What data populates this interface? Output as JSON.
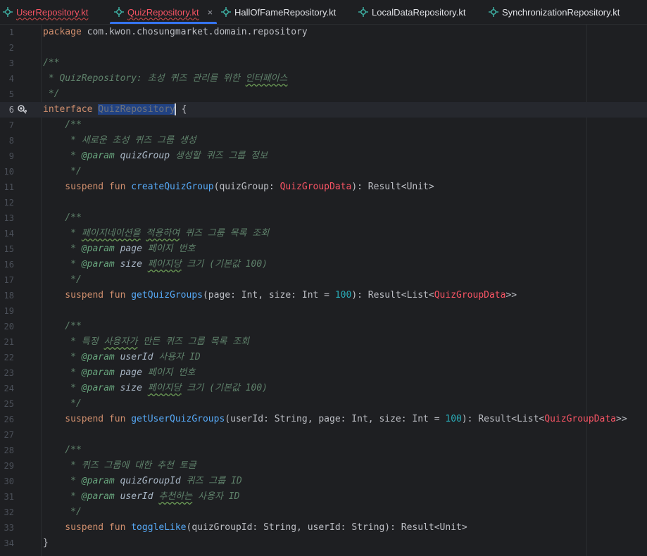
{
  "tabs": [
    {
      "label": "UserRepository.kt",
      "active": false,
      "error": true
    },
    {
      "label": "QuizRepository.kt",
      "active": true,
      "error": true,
      "close": "×"
    },
    {
      "label": "HallOfFameRepository.kt",
      "active": false,
      "error": false
    },
    {
      "label": "LocalDataRepository.kt",
      "active": false,
      "error": false
    },
    {
      "label": "SynchronizationRepository.kt",
      "active": false,
      "error": false
    }
  ],
  "icons": {
    "tab_file_icon": "kotlin-interface-file-icon",
    "gutter_icon": "implemented-interface-icon"
  },
  "colors": {
    "keyword": "#cf8e6d",
    "function": "#56a8f5",
    "doc_comment": "#5f826b",
    "error_type": "#f75464",
    "number": "#2aacb8",
    "selection": "#214283"
  },
  "editor": {
    "current_line": 6,
    "lines": [
      {
        "n": "1",
        "segs": [
          [
            "kw",
            "package "
          ],
          [
            "plain",
            "com.kwon.chosungmarket.domain.repository"
          ]
        ]
      },
      {
        "n": "2",
        "segs": []
      },
      {
        "n": "3",
        "segs": [
          [
            "doc",
            "/**"
          ]
        ]
      },
      {
        "n": "4",
        "segs": [
          [
            "doc",
            " * QuizRepository: 초성 퀴즈 관리를 위한 "
          ],
          [
            "doc wavy",
            "인터페이스"
          ]
        ]
      },
      {
        "n": "5",
        "segs": [
          [
            "doc",
            " */"
          ]
        ]
      },
      {
        "n": "6",
        "segs": [
          [
            "kw",
            "interface "
          ],
          [
            "hl",
            "QuizRepository"
          ],
          [
            "caret",
            ""
          ],
          [
            "plain",
            " {"
          ]
        ]
      },
      {
        "n": "7",
        "segs": [
          [
            "doc",
            "    /**"
          ]
        ]
      },
      {
        "n": "8",
        "segs": [
          [
            "doc",
            "     * 새로운 초성 퀴즈 그룹 생성"
          ]
        ]
      },
      {
        "n": "9",
        "segs": [
          [
            "doc",
            "     * "
          ],
          [
            "tag",
            "@param"
          ],
          [
            "prm",
            " quizGroup"
          ],
          [
            "doc",
            " 생성할 퀴즈 그룹 정보"
          ]
        ]
      },
      {
        "n": "10",
        "segs": [
          [
            "doc",
            "     */"
          ]
        ]
      },
      {
        "n": "11",
        "segs": [
          [
            "kw",
            "    suspend fun "
          ],
          [
            "fn",
            "createQuizGroup"
          ],
          [
            "plain",
            "(quizGroup: "
          ],
          [
            "err",
            "QuizGroupData"
          ],
          [
            "plain",
            "): Result<Unit>"
          ]
        ]
      },
      {
        "n": "12",
        "segs": []
      },
      {
        "n": "13",
        "segs": [
          [
            "doc",
            "    /**"
          ]
        ]
      },
      {
        "n": "14",
        "segs": [
          [
            "doc",
            "     * "
          ],
          [
            "doc wavy",
            "페이지네이션을"
          ],
          [
            "doc",
            " "
          ],
          [
            "doc wavy",
            "적용하여"
          ],
          [
            "doc",
            " 퀴즈 그룹 목록 조회"
          ]
        ]
      },
      {
        "n": "15",
        "segs": [
          [
            "doc",
            "     * "
          ],
          [
            "tag",
            "@param"
          ],
          [
            "prm",
            " page"
          ],
          [
            "doc",
            " 페이지 번호"
          ]
        ]
      },
      {
        "n": "16",
        "segs": [
          [
            "doc",
            "     * "
          ],
          [
            "tag",
            "@param"
          ],
          [
            "prm",
            " size"
          ],
          [
            "doc",
            " "
          ],
          [
            "doc wavy",
            "페이지당"
          ],
          [
            "doc",
            " 크기 (기본값 100)"
          ]
        ]
      },
      {
        "n": "17",
        "segs": [
          [
            "doc",
            "     */"
          ]
        ]
      },
      {
        "n": "18",
        "segs": [
          [
            "kw",
            "    suspend fun "
          ],
          [
            "fn",
            "getQuizGroups"
          ],
          [
            "plain",
            "(page: Int, size: Int = "
          ],
          [
            "num",
            "100"
          ],
          [
            "plain",
            "): Result<List<"
          ],
          [
            "err",
            "QuizGroupData"
          ],
          [
            "plain",
            ">>"
          ]
        ]
      },
      {
        "n": "19",
        "segs": []
      },
      {
        "n": "20",
        "segs": [
          [
            "doc",
            "    /**"
          ]
        ]
      },
      {
        "n": "21",
        "segs": [
          [
            "doc",
            "     * 특정 "
          ],
          [
            "doc wavy",
            "사용자가"
          ],
          [
            "doc",
            " 만든 퀴즈 그룹 목록 조회"
          ]
        ]
      },
      {
        "n": "22",
        "segs": [
          [
            "doc",
            "     * "
          ],
          [
            "tag",
            "@param"
          ],
          [
            "prm",
            " userId"
          ],
          [
            "doc",
            " 사용자 ID"
          ]
        ]
      },
      {
        "n": "23",
        "segs": [
          [
            "doc",
            "     * "
          ],
          [
            "tag",
            "@param"
          ],
          [
            "prm",
            " page"
          ],
          [
            "doc",
            " 페이지 번호"
          ]
        ]
      },
      {
        "n": "24",
        "segs": [
          [
            "doc",
            "     * "
          ],
          [
            "tag",
            "@param"
          ],
          [
            "prm",
            " size"
          ],
          [
            "doc",
            " "
          ],
          [
            "doc wavy",
            "페이지당"
          ],
          [
            "doc",
            " 크기 (기본값 100)"
          ]
        ]
      },
      {
        "n": "25",
        "segs": [
          [
            "doc",
            "     */"
          ]
        ]
      },
      {
        "n": "26",
        "segs": [
          [
            "kw",
            "    suspend fun "
          ],
          [
            "fn",
            "getUserQuizGroups"
          ],
          [
            "plain",
            "(userId: String, page: Int, size: Int = "
          ],
          [
            "num",
            "100"
          ],
          [
            "plain",
            "): Result<List<"
          ],
          [
            "err",
            "QuizGroupData"
          ],
          [
            "plain",
            ">>"
          ]
        ]
      },
      {
        "n": "27",
        "segs": []
      },
      {
        "n": "28",
        "segs": [
          [
            "doc",
            "    /**"
          ]
        ]
      },
      {
        "n": "29",
        "segs": [
          [
            "doc",
            "     * 퀴즈 그룹에 대한 추천 토글"
          ]
        ]
      },
      {
        "n": "30",
        "segs": [
          [
            "doc",
            "     * "
          ],
          [
            "tag",
            "@param"
          ],
          [
            "prm",
            " quizGroupId"
          ],
          [
            "doc",
            " 퀴즈 그룹 ID"
          ]
        ]
      },
      {
        "n": "31",
        "segs": [
          [
            "doc",
            "     * "
          ],
          [
            "tag",
            "@param"
          ],
          [
            "prm",
            " userId"
          ],
          [
            "doc",
            " "
          ],
          [
            "doc wavy",
            "추천하는"
          ],
          [
            "doc",
            " 사용자 ID"
          ]
        ]
      },
      {
        "n": "32",
        "segs": [
          [
            "doc",
            "     */"
          ]
        ]
      },
      {
        "n": "33",
        "segs": [
          [
            "kw",
            "    suspend fun "
          ],
          [
            "fn",
            "toggleLike"
          ],
          [
            "plain",
            "(quizGroupId: String, userId: String): Result<Unit>"
          ]
        ]
      },
      {
        "n": "34",
        "segs": [
          [
            "plain",
            "}"
          ]
        ]
      }
    ]
  }
}
